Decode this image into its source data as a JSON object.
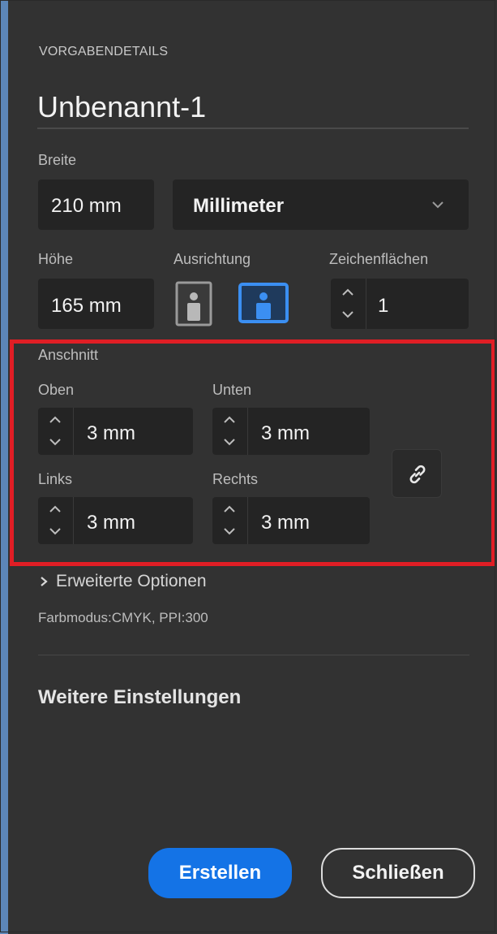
{
  "section_title": "VORGABENDETAILS",
  "doc_name": "Unbenannt-1",
  "width": {
    "label": "Breite",
    "value": "210 mm"
  },
  "unit": {
    "value": "Millimeter"
  },
  "height": {
    "label": "Höhe",
    "value": "165 mm"
  },
  "orientation": {
    "label": "Ausrichtung",
    "selected": "landscape"
  },
  "artboards": {
    "label": "Zeichenflächen",
    "value": "1"
  },
  "bleed": {
    "label": "Anschnitt",
    "top": {
      "label": "Oben",
      "value": "3 mm"
    },
    "bottom": {
      "label": "Unten",
      "value": "3 mm"
    },
    "left": {
      "label": "Links",
      "value": "3 mm"
    },
    "right": {
      "label": "Rechts",
      "value": "3 mm"
    }
  },
  "advanced": {
    "label": "Erweiterte Optionen"
  },
  "color_info": "Farbmodus:CMYK, PPI:300",
  "more_settings": "Weitere Einstellungen",
  "buttons": {
    "create": "Erstellen",
    "close": "Schließen"
  },
  "colors": {
    "accent": "#1473e6",
    "highlight": "#e01e25",
    "background": "#323232",
    "field": "#242424"
  }
}
